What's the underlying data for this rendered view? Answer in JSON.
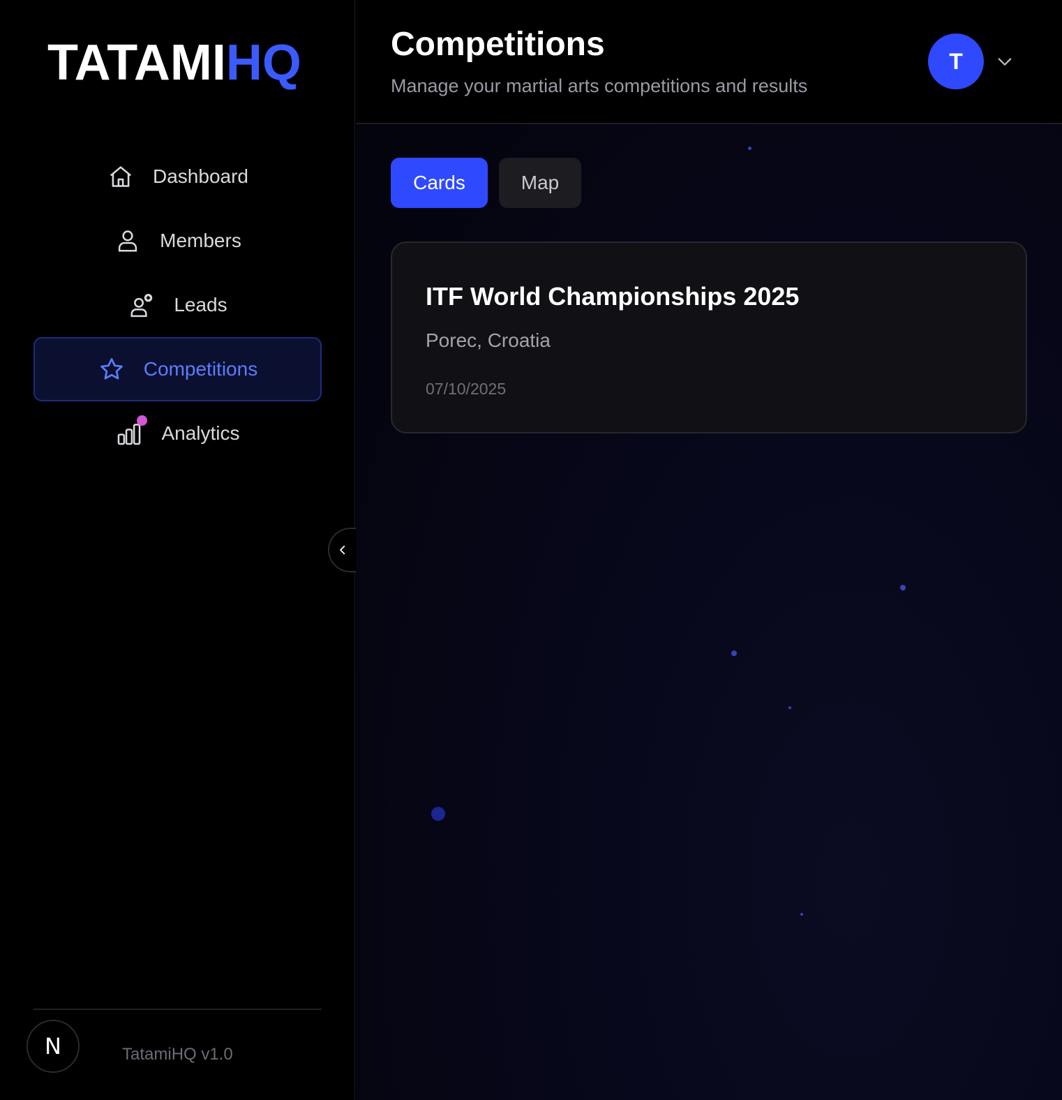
{
  "brand": {
    "part1": "TATAMI",
    "part2": "HQ"
  },
  "nav": [
    {
      "label": "Dashboard",
      "icon": "home-icon",
      "active": false
    },
    {
      "label": "Members",
      "icon": "user-icon",
      "active": false
    },
    {
      "label": "Leads",
      "icon": "user-plus-icon",
      "active": false
    },
    {
      "label": "Competitions",
      "icon": "star-icon",
      "active": true
    },
    {
      "label": "Analytics",
      "icon": "bar-chart-icon",
      "active": false,
      "has_notification_dot": true
    }
  ],
  "footer": {
    "badge": "N",
    "version": "TatamiHQ v1.0"
  },
  "header": {
    "title": "Competitions",
    "subtitle": "Manage your martial arts competitions and results",
    "avatar_initial": "T"
  },
  "view_tabs": [
    {
      "label": "Cards",
      "selected": true
    },
    {
      "label": "Map",
      "selected": false
    }
  ],
  "competitions": [
    {
      "title": "ITF World Championships 2025",
      "location": "Porec, Croatia",
      "date": "07/10/2025"
    }
  ],
  "colors": {
    "accent": "#2f49ff",
    "brand_blue": "#3b5bff",
    "active_nav_text": "#5b7dff",
    "notification_dot": "#d258d8"
  }
}
